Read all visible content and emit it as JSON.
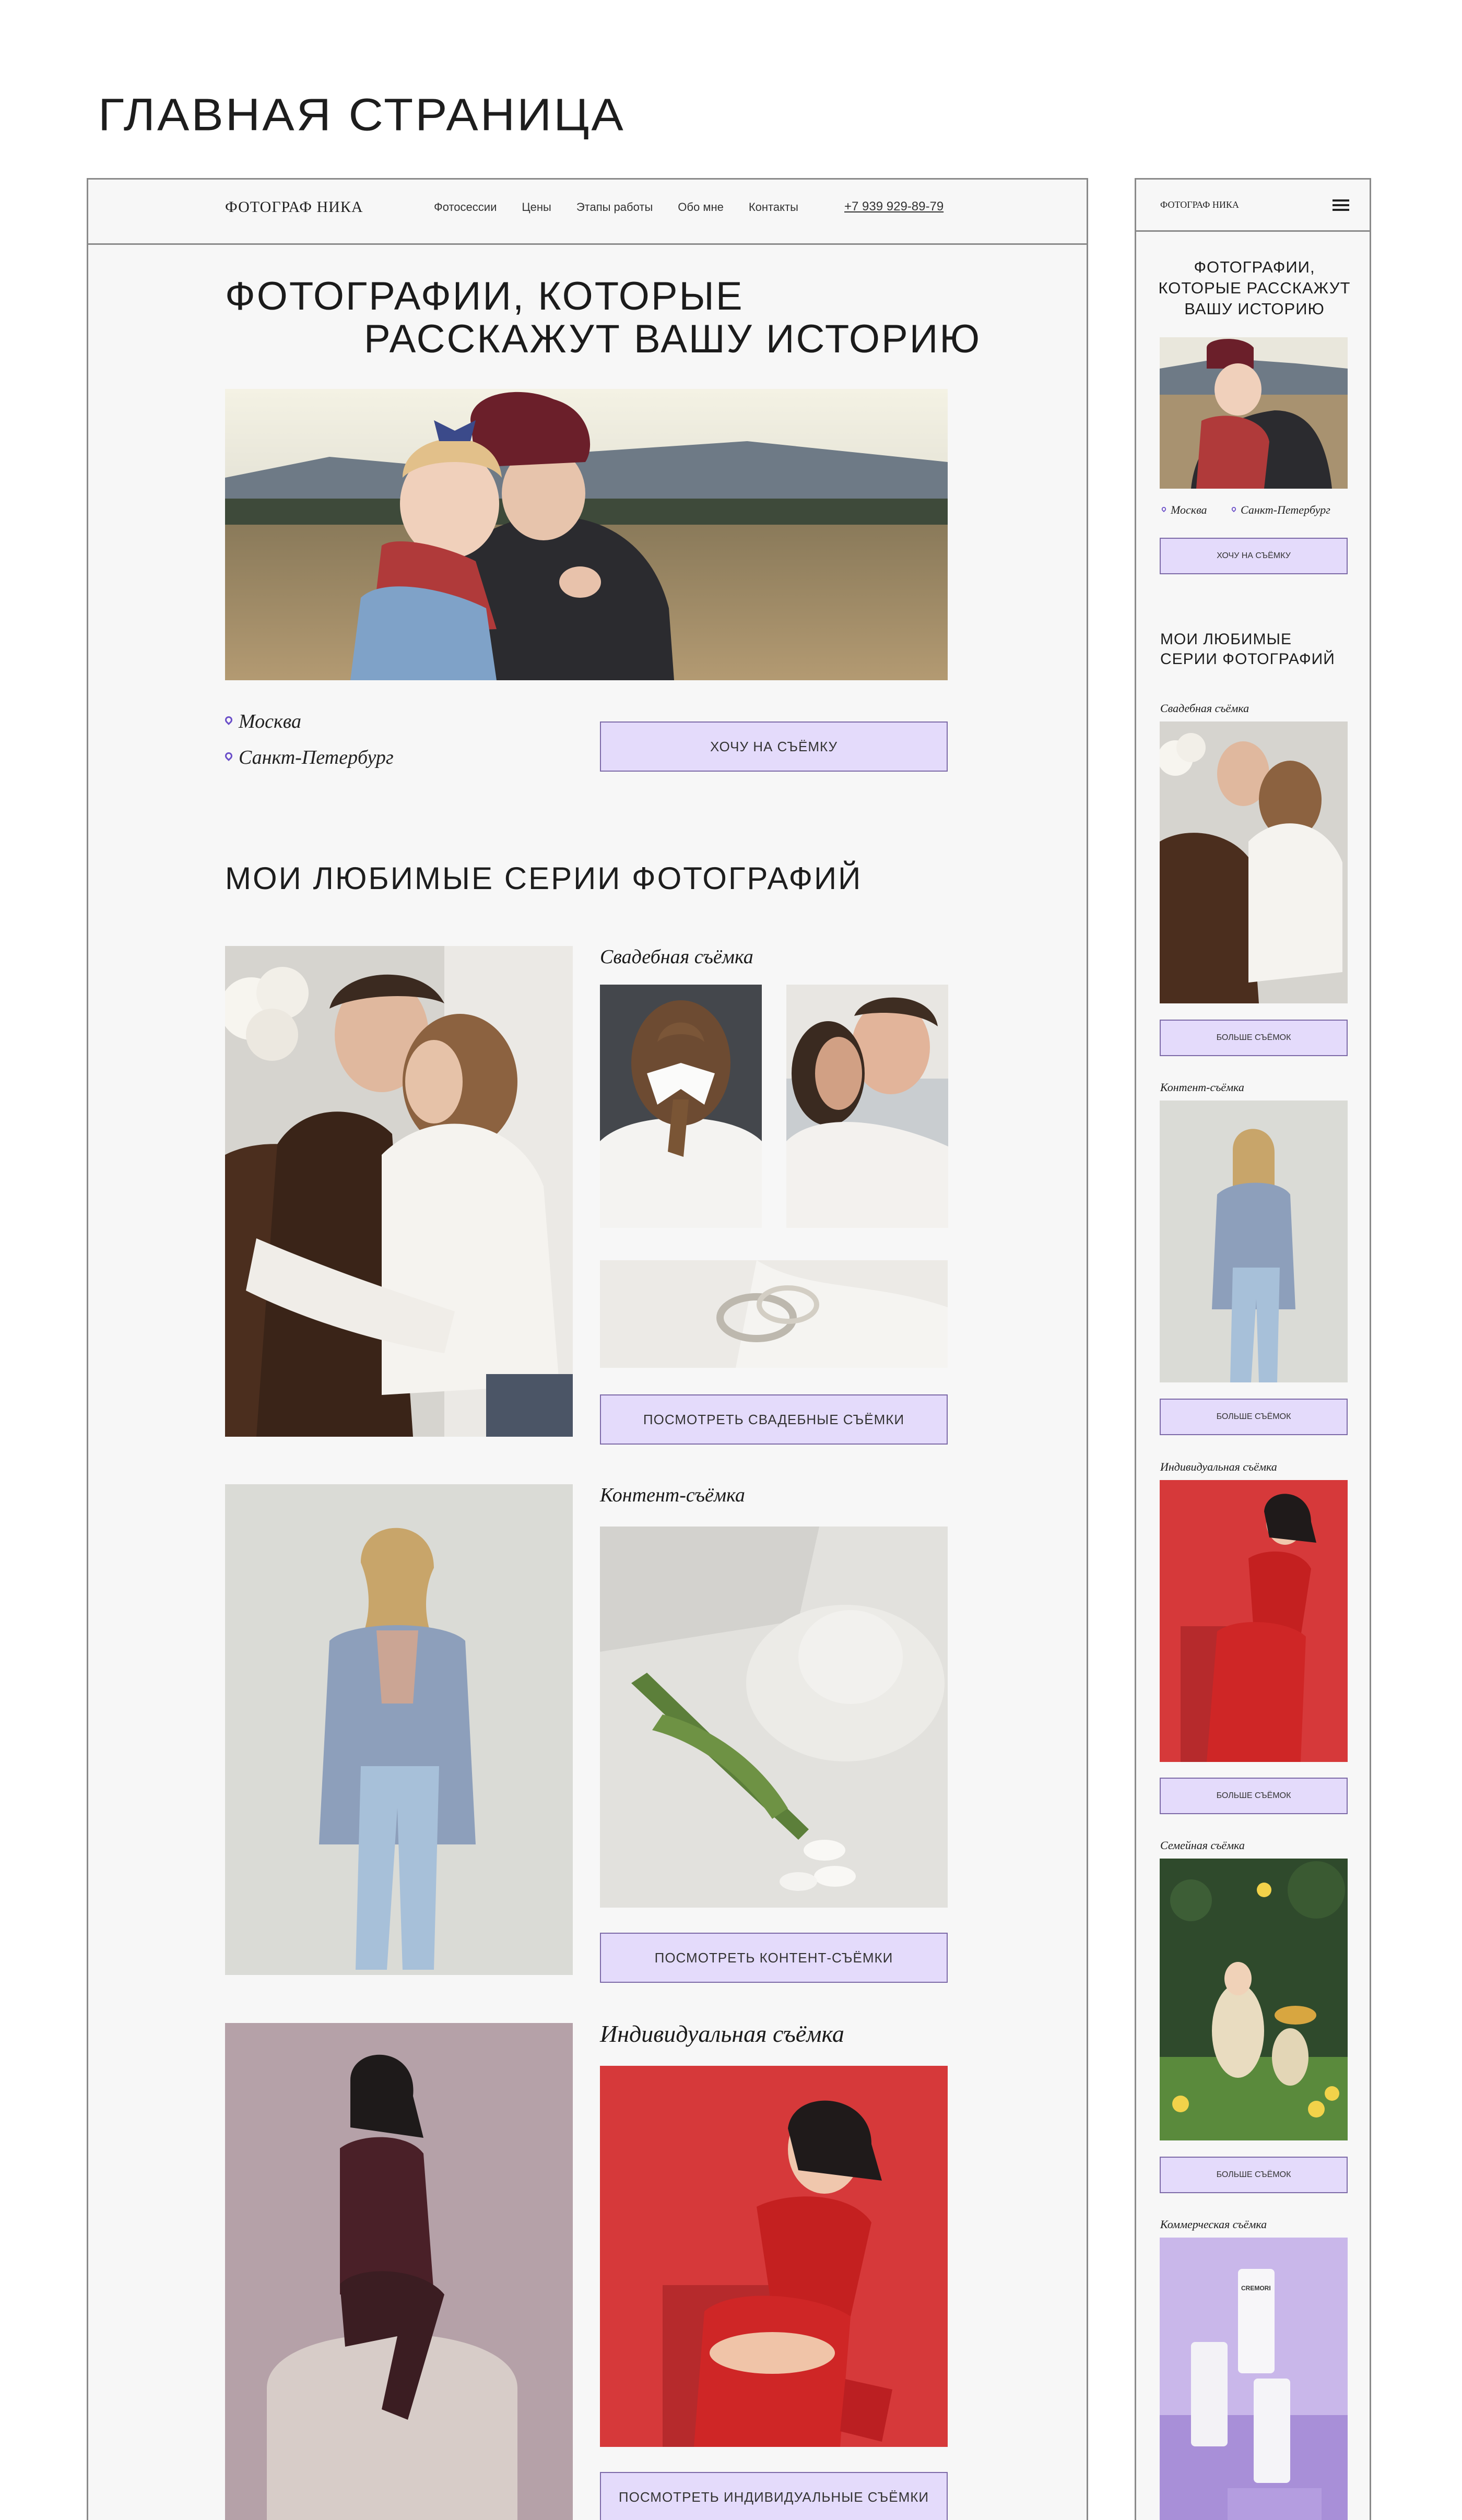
{
  "page_heading": "ГЛАВНАЯ СТРАНИЦА",
  "desktop": {
    "logo": "ФОТОГРАФ НИКА",
    "nav": [
      "Фотосессии",
      "Цены",
      "Этапы работы",
      "Обо мне",
      "Контакты"
    ],
    "phone": "+7 939 929-89-79",
    "hero_line1": "ФОТОГРАФИИ, КОТОРЫЕ",
    "hero_line2": "РАССКАЖУТ ВАШУ ИСТОРИЮ",
    "locations": [
      "Москва",
      "Санкт-Петербург"
    ],
    "cta": "ХОЧУ НА СЪЁМКУ",
    "series_heading": "МОИ ЛЮБИМЫЕ СЕРИИ ФОТОГРАФИЙ",
    "series": [
      {
        "title": "Свадебная съёмка",
        "button": "ПОСМОТРЕТЬ СВАДЕБНЫЕ СЪЁМКИ"
      },
      {
        "title": "Контент-съёмка",
        "button": "ПОСМОТРЕТЬ КОНТЕНТ-СЪЁМКИ"
      },
      {
        "title": "Индивидуальная съёмка",
        "button": "ПОСМОТРЕТЬ ИНДИВИДУАЛЬНЫЕ СЪЁМКИ"
      }
    ]
  },
  "mobile": {
    "logo": "ФОТОГРАФ НИКА",
    "hero": "ФОТОГРАФИИ, КОТОРЫЕ РАССКАЖУТ ВАШУ ИСТОРИЮ",
    "locations": [
      "Москва",
      "Санкт-Петербург"
    ],
    "cta": "ХОЧУ НА СЪЁМКУ",
    "series_heading": "МОИ ЛЮБИМЫЕ СЕРИИ ФОТОГРАФИЙ",
    "series": [
      {
        "title": "Свадебная съёмка",
        "button": "БОЛЬШЕ СЪЁМОК"
      },
      {
        "title": "Контент-съёмка",
        "button": "БОЛЬШЕ СЪЁМОК"
      },
      {
        "title": "Индивидуальная съёмка",
        "button": "БОЛЬШЕ СЪЁМОК"
      },
      {
        "title": "Семейная съёмка",
        "button": "БОЛЬШЕ СЪЁМОК"
      },
      {
        "title": "Коммерческая съёмка"
      }
    ],
    "product_brand": "CREMORI"
  },
  "colors": {
    "accent_button": "#e4dbfb",
    "accent_pin": "#6b4fc9",
    "frame_border": "#8a8a8a",
    "background": "#f7f7f7"
  }
}
